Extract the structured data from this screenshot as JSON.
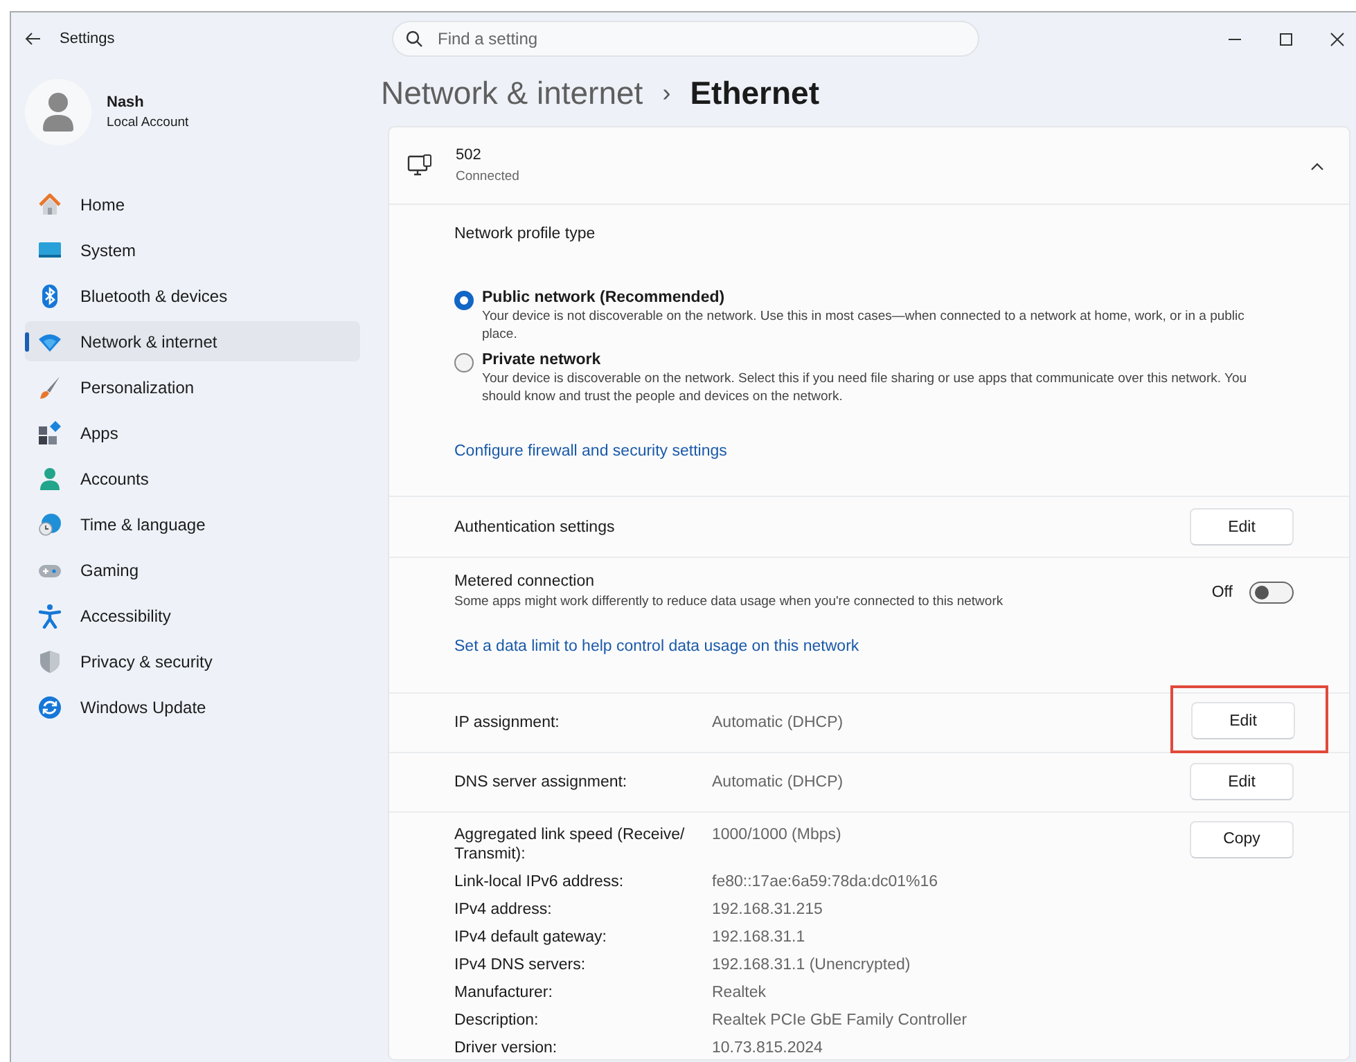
{
  "window": {
    "title": "Settings"
  },
  "search": {
    "placeholder": "Find a setting"
  },
  "account": {
    "name": "Nash",
    "type": "Local Account"
  },
  "sidebar": {
    "items": [
      {
        "label": "Home",
        "kind": "home",
        "selected": false
      },
      {
        "label": "System",
        "kind": "system",
        "selected": false
      },
      {
        "label": "Bluetooth & devices",
        "kind": "bluetooth",
        "selected": false
      },
      {
        "label": "Network & internet",
        "kind": "wifi",
        "selected": true
      },
      {
        "label": "Personalization",
        "kind": "brush",
        "selected": false
      },
      {
        "label": "Apps",
        "kind": "apps",
        "selected": false
      },
      {
        "label": "Accounts",
        "kind": "person",
        "selected": false
      },
      {
        "label": "Time & language",
        "kind": "globe",
        "selected": false
      },
      {
        "label": "Gaming",
        "kind": "gamepad",
        "selected": false
      },
      {
        "label": "Accessibility",
        "kind": "accessibility",
        "selected": false
      },
      {
        "label": "Privacy & security",
        "kind": "shield",
        "selected": false
      },
      {
        "label": "Windows Update",
        "kind": "update",
        "selected": false
      }
    ]
  },
  "breadcrumb": {
    "parent": "Network & internet",
    "separator": "›",
    "current": "Ethernet"
  },
  "connection": {
    "name": "502",
    "status": "Connected",
    "expanded": true
  },
  "profile": {
    "heading": "Network profile type",
    "options": [
      {
        "label": "Public network (Recommended)",
        "description": "Your device is not discoverable on the network. Use this in most cases—when connected to a network at home, work, or in a public place.",
        "selected": true
      },
      {
        "label": "Private network",
        "description": "Your device is discoverable on the network. Select this if you need file sharing or use apps that communicate over this network. You should know and trust the people and devices on the network.",
        "selected": false
      }
    ],
    "link": "Configure firewall and security settings"
  },
  "authentication": {
    "label": "Authentication settings",
    "button": "Edit"
  },
  "metered": {
    "label": "Metered connection",
    "description": "Some apps might work differently to reduce data usage when you're connected to this network",
    "toggle": {
      "label": "Off",
      "on": false
    },
    "link": "Set a data limit to help control data usage on this network"
  },
  "assignments": [
    {
      "label": "IP assignment:",
      "value": "Automatic (DHCP)",
      "button": "Edit",
      "highlighted": true
    },
    {
      "label": "DNS server assignment:",
      "value": "Automatic (DHCP)",
      "button": "Edit",
      "highlighted": false
    }
  ],
  "properties": {
    "button": "Copy",
    "rows": [
      {
        "label": "Aggregated link speed (Receive/ Transmit):",
        "value": "1000/1000 (Mbps)"
      },
      {
        "label": "Link-local IPv6 address:",
        "value": "fe80::17ae:6a59:78da:dc01%16"
      },
      {
        "label": "IPv4 address:",
        "value": "192.168.31.215"
      },
      {
        "label": "IPv4 default gateway:",
        "value": "192.168.31.1"
      },
      {
        "label": "IPv4 DNS servers:",
        "value": "192.168.31.1 (Unencrypted)"
      },
      {
        "label": "Manufacturer:",
        "value": "Realtek"
      },
      {
        "label": "Description:",
        "value": "Realtek PCIe GbE Family Controller"
      },
      {
        "label": "Driver version:",
        "value": "10.73.815.2024"
      }
    ]
  }
}
